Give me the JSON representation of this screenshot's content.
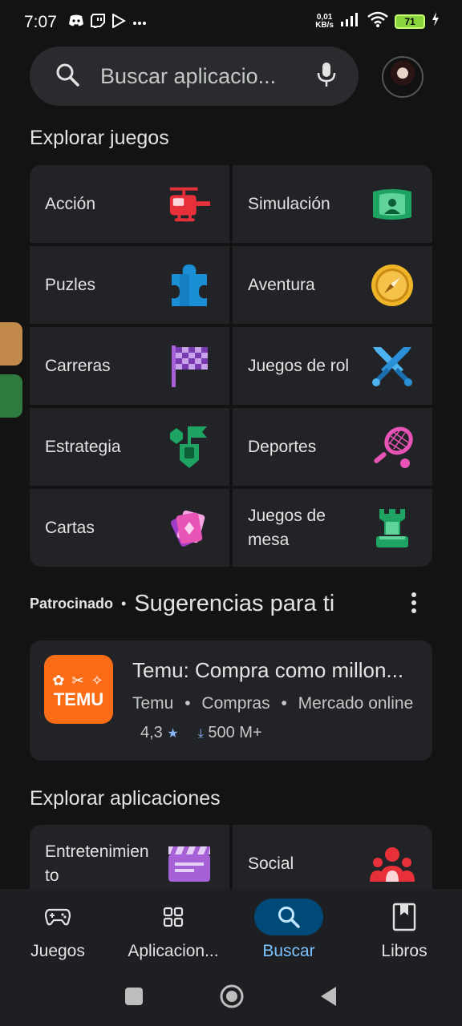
{
  "status": {
    "time": "7:07",
    "net_speed_value": "0,01",
    "net_speed_unit": "KB/s",
    "battery": "71",
    "app_icons": [
      "discord-icon",
      "twitch-icon",
      "play-store-icon",
      "more-dots-icon"
    ]
  },
  "search": {
    "placeholder": "Buscar aplicacio..."
  },
  "games_section": {
    "title": "Explorar juegos",
    "categories": [
      {
        "label": "Acción",
        "icon": "helicopter-icon"
      },
      {
        "label": "Simulación",
        "icon": "simulator-icon"
      },
      {
        "label": "Puzles",
        "icon": "puzzle-piece-icon"
      },
      {
        "label": "Aventura",
        "icon": "compass-icon"
      },
      {
        "label": "Carreras",
        "icon": "checkered-flag-icon"
      },
      {
        "label": "Juegos de rol",
        "icon": "crossed-swords-icon"
      },
      {
        "label": "Estrategia",
        "icon": "strategy-icon"
      },
      {
        "label": "Deportes",
        "icon": "tennis-racket-icon"
      },
      {
        "label": "Cartas",
        "icon": "cards-icon"
      },
      {
        "label": "Juegos de mesa",
        "icon": "chess-rook-icon"
      }
    ]
  },
  "suggestions": {
    "sponsored": "Patrocinado",
    "separator": "•",
    "title": "Sugerencias para ti",
    "app": {
      "logo_text": "TEMU",
      "name": "Temu: Compra como millon...",
      "developer": "Temu",
      "category": "Compras",
      "tag": "Mercado online",
      "rating": "4,3",
      "downloads": "500 M+"
    }
  },
  "apps_section": {
    "title": "Explorar aplicaciones",
    "categories": [
      {
        "label": "Entretenimien to",
        "icon": "clapperboard-icon"
      },
      {
        "label": "Social",
        "icon": "people-icon"
      }
    ]
  },
  "bottom_nav": {
    "items": [
      {
        "label": "Juegos",
        "icon": "gamepad-icon"
      },
      {
        "label": "Aplicacion...",
        "icon": "apps-grid-icon"
      },
      {
        "label": "Buscar",
        "icon": "search-icon"
      },
      {
        "label": "Libros",
        "icon": "book-icon"
      }
    ],
    "active": "Buscar"
  },
  "colors": {
    "background": "#131314",
    "tile": "#222326",
    "active_nav": "#004a77",
    "active_label": "#7cc2ff",
    "temu_brand": "#fb6c16"
  }
}
